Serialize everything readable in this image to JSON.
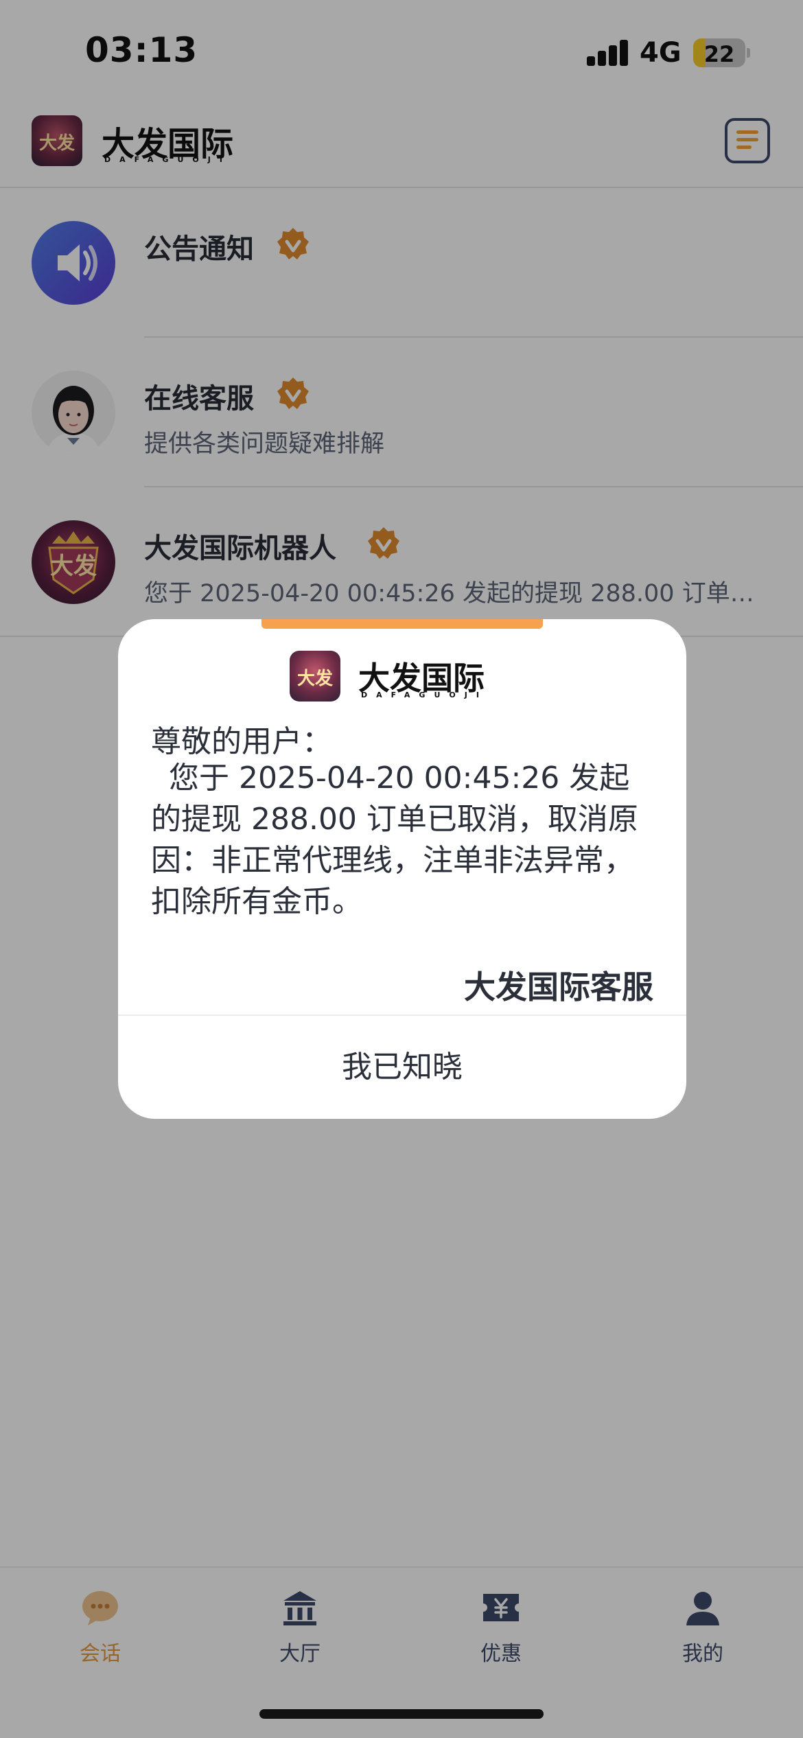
{
  "status_bar": {
    "time": "03:13",
    "network": "4G",
    "battery": "22",
    "battery_level": 0.22
  },
  "header": {
    "brand_name": "大发国际",
    "brand_sub": "DAFAGUOJI",
    "logo_text": "大发"
  },
  "chats": [
    {
      "title": "公告通知",
      "subtitle": "",
      "avatar": "speaker-icon"
    },
    {
      "title": "在线客服",
      "subtitle": "提供各类问题疑难排解",
      "avatar": "customer-service-avatar"
    },
    {
      "title": "大发国际机器人",
      "subtitle": "您于 2025-04-20 00:45:26 发起的提现 288.00 订单已取消，取消原因：非正常代理线，注单非法异常，扣除所有金币。",
      "avatar": "robot-avatar",
      "avatar_text": "大发"
    }
  ],
  "modal": {
    "brand_name": "大发国际",
    "brand_sub": "DAFAGUOJI",
    "logo_text": "大发",
    "greeting": "尊敬的用户：",
    "body": "您于 2025-04-20 00:45:26 发起的提现 288.00 订单已取消，取消原因：非正常代理线，注单非法异常，扣除所有金币。",
    "signature": "大发国际客服",
    "confirm_label": "我已知晓"
  },
  "tabbar": {
    "tabs": [
      {
        "label": "会话",
        "icon": "chat-bubbles-icon",
        "active": true
      },
      {
        "label": "大厅",
        "icon": "hall-icon",
        "active": false
      },
      {
        "label": "优惠",
        "icon": "coupon-icon",
        "active": false
      },
      {
        "label": "我的",
        "icon": "user-icon",
        "active": false
      }
    ]
  },
  "colors": {
    "accent": "#e79a3f",
    "badge": "#e08a2e",
    "nav": "#3d4a6b",
    "overlay": "rgba(0,0,0,0.34)"
  }
}
